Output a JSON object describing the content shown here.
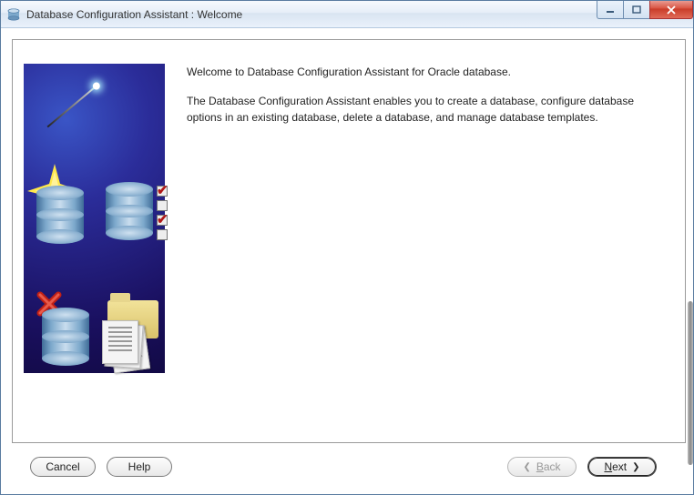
{
  "window": {
    "title": "Database Configuration Assistant : Welcome"
  },
  "content": {
    "welcome_line": "Welcome to Database Configuration Assistant for Oracle database.",
    "description": "The Database Configuration Assistant enables you to create a database, configure database options in an existing database, delete a database, and manage database templates."
  },
  "buttons": {
    "cancel": "Cancel",
    "help": "Help",
    "back_prefix": "B",
    "back_rest": "ack",
    "next_prefix": "N",
    "next_rest": "ext"
  }
}
